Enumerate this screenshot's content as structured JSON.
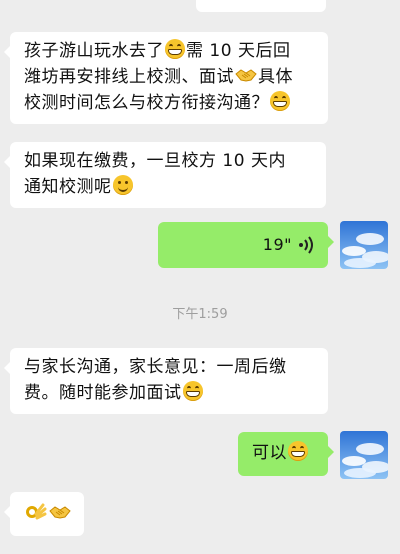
{
  "messages": [
    {
      "id": "m0",
      "side": "left",
      "partial": true
    },
    {
      "id": "m1",
      "side": "left",
      "lines": [
        "孩子游山玩水去了",
        "需 10 天后回",
        "潍坊再安排线上校测、面试",
        "具体",
        "校测时间怎么与校方衔接沟通？"
      ],
      "emojis": [
        "grin-emoji",
        "handshake-emoji",
        "grin-emoji"
      ]
    },
    {
      "id": "m2",
      "side": "left",
      "lines": [
        "如果现在缴费，一旦校方 10 天内",
        "通知校测呢"
      ],
      "emojis": [
        "smile-emoji"
      ]
    },
    {
      "id": "m3",
      "side": "right",
      "type": "voice",
      "duration": "19\""
    },
    {
      "id": "ts",
      "type": "timestamp",
      "text": "下午1:59"
    },
    {
      "id": "m4",
      "side": "left",
      "lines": [
        "与家长沟通，家长意见：一周后缴",
        "费。随时能参加面试"
      ],
      "emojis": [
        "grin-emoji"
      ]
    },
    {
      "id": "m5",
      "side": "right",
      "text": "可以",
      "emojis": [
        "grin-emoji"
      ]
    },
    {
      "id": "m6",
      "side": "left",
      "emojis": [
        "ok-hand-emoji",
        "handshake-emoji"
      ]
    }
  ],
  "colors": {
    "background": "#ededed",
    "bubble_left": "#ffffff",
    "bubble_right": "#95ec69",
    "timestamp": "#9e9e9e"
  }
}
